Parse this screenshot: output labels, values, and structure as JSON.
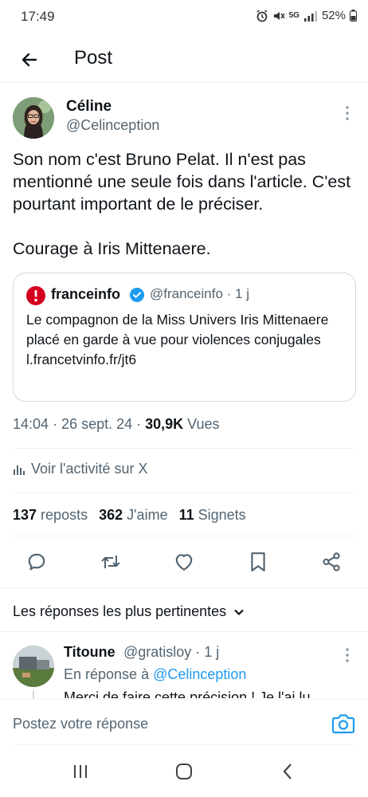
{
  "status_bar": {
    "time": "17:49",
    "network": "5G",
    "battery": "52%"
  },
  "header": {
    "title": "Post",
    "back_icon": "arrow-left-icon"
  },
  "tweet": {
    "author_name": "Céline",
    "author_handle": "@Celinception",
    "text": "Son nom c'est Bruno Pelat. Il n'est pas mentionné une seule fois dans l'article. C'est pourtant important de le préciser.\n\nCourage à Iris Mittenaere.",
    "quote": {
      "name": "franceinfo",
      "meta": "@franceinfo · 1 j",
      "text": "Le compagnon de la Miss Univers Iris Mittenaere placé en garde à vue pour violences conjugales\nl.francetvinfo.fr/jt6"
    },
    "time_date": "14:04 · 26 sept. 24 · ",
    "views_count": "30,9K",
    "views_label": " Vues",
    "activity_label": "Voir l'activité sur X",
    "reposts_count": "137",
    "reposts_label": "reposts",
    "likes_count": "362",
    "likes_label": "J'aime",
    "bookmarks_count": "11",
    "bookmarks_label": "Signets"
  },
  "replies_sort": {
    "label": "Les réponses les plus pertinentes"
  },
  "reply": {
    "name": "Titoune",
    "meta": "@gratisloy · 1 j",
    "in_reply_prefix": "En réponse à ",
    "in_reply_handle": "@Celinception",
    "text": "Merci de faire cette précision ! Je l'ai lu"
  },
  "compose": {
    "placeholder": "Postez votre réponse"
  },
  "colors": {
    "accent": "#1d9bf0",
    "secondary_text": "#536471",
    "franceinfo_red": "#d4001f"
  }
}
